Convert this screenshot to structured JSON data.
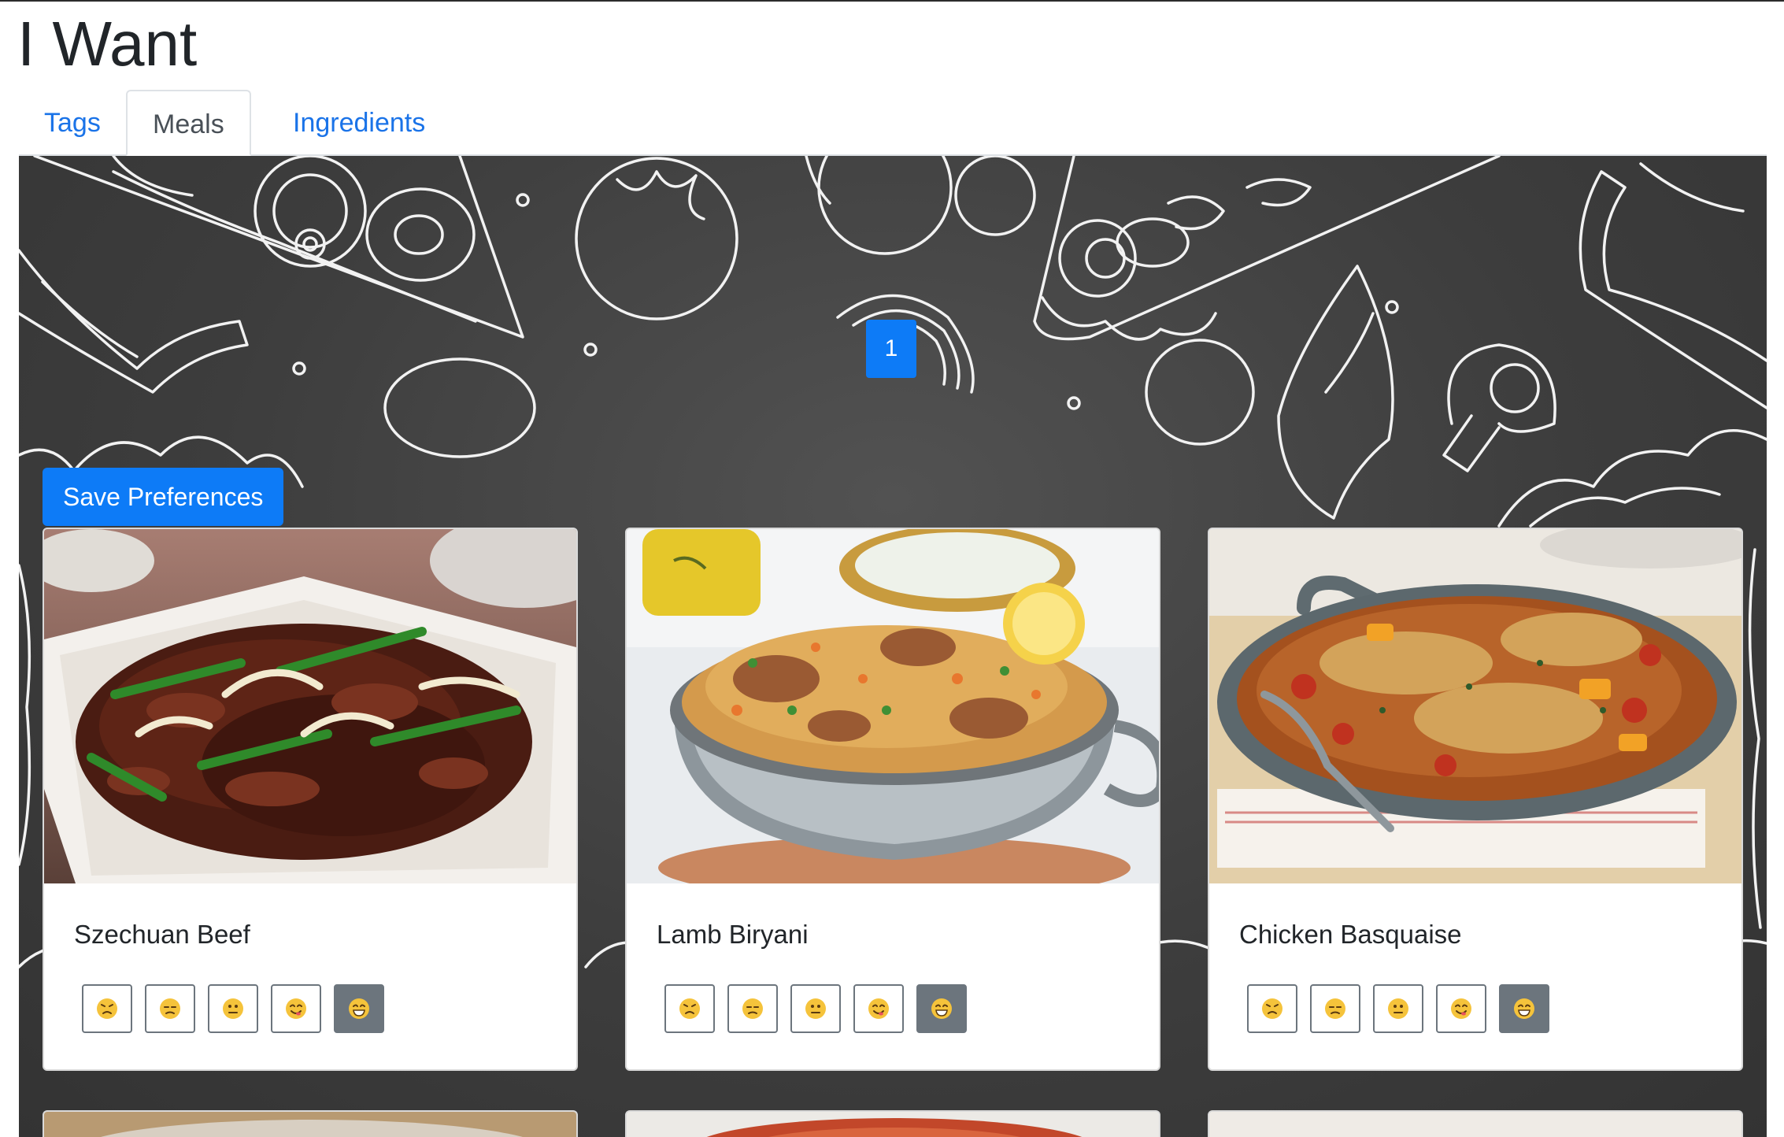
{
  "app": {
    "title": "I Want"
  },
  "tabs": [
    {
      "label": "Tags",
      "active": false
    },
    {
      "label": "Meals",
      "active": true
    },
    {
      "label": "Ingredients",
      "active": false
    }
  ],
  "pagination": {
    "current_page": "1"
  },
  "actions": {
    "save_label": "Save Preferences"
  },
  "meals": [
    {
      "name": "Szechuan Beef",
      "rating_selected": 5
    },
    {
      "name": "Lamb Biryani",
      "rating_selected": 5
    },
    {
      "name": "Chicken Basquaise",
      "rating_selected": 5
    }
  ],
  "rating_icons": [
    "angry-face-icon",
    "unamused-face-icon",
    "neutral-face-icon",
    "yum-face-icon",
    "grinning-face-icon"
  ],
  "colors": {
    "accent": "#0d7bf7",
    "link": "#1a73e8",
    "selected_rating": "#6c757d",
    "banner_background": "#3d3d3d"
  }
}
